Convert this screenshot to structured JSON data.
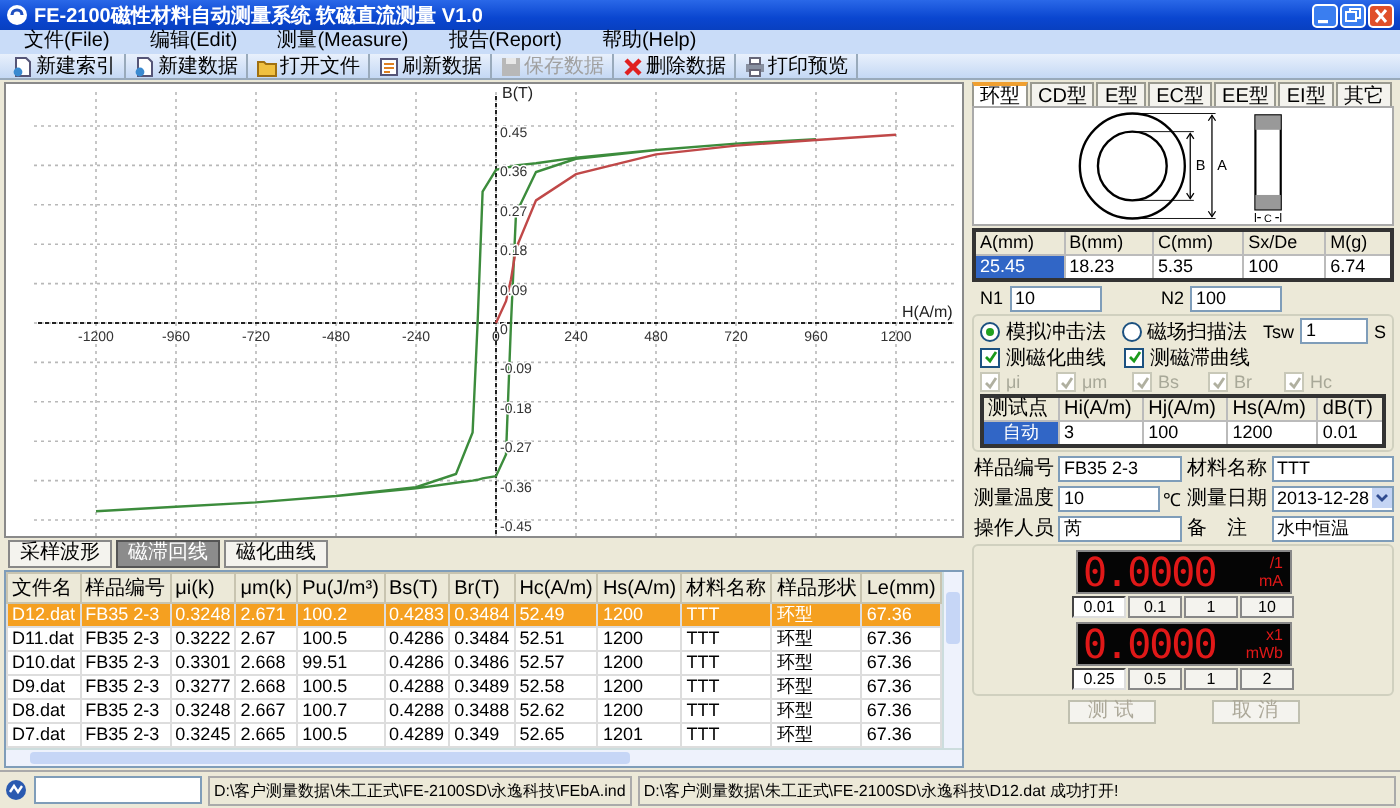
{
  "window": {
    "title": "FE-2100磁性材料自动测量系统 软磁直流测量 V1.0"
  },
  "menu": [
    "文件(File)",
    "编辑(Edit)",
    "测量(Measure)",
    "报告(Report)",
    "帮助(Help)"
  ],
  "toolbar": [
    {
      "label": "新建索引",
      "disabled": false
    },
    {
      "label": "新建数据",
      "disabled": false
    },
    {
      "label": "打开文件",
      "disabled": false
    },
    {
      "label": "刷新数据",
      "disabled": false
    },
    {
      "label": "保存数据",
      "disabled": true
    },
    {
      "label": "删除数据",
      "disabled": false
    },
    {
      "label": "打印预览",
      "disabled": false
    }
  ],
  "chart": {
    "chart_data": {
      "type": "line",
      "xlabel": "H(A/m)",
      "ylabel": "B(T)",
      "x": [
        -1200,
        -960,
        -720,
        -480,
        -240,
        -120,
        -70,
        -55,
        -40,
        0,
        30,
        45,
        60,
        120,
        240,
        480,
        720,
        960,
        1200
      ],
      "series": [
        {
          "color": "#3c8c3c",
          "values": [
            -0.43,
            -0.42,
            -0.41,
            -0.395,
            -0.375,
            -0.345,
            -0.25,
            0.0,
            0.3,
            0.35,
            0.355,
            0.357,
            0.36,
            0.365,
            0.378,
            0.395,
            0.41,
            0.42,
            null
          ]
        },
        {
          "color": "#3c8c3c",
          "values": [
            -0.43,
            -0.42,
            -0.41,
            -0.395,
            -0.378,
            -0.365,
            -0.36,
            -0.358,
            -0.355,
            -0.35,
            -0.3,
            0.0,
            0.25,
            0.345,
            0.375,
            0.395,
            0.41,
            0.42,
            null
          ]
        },
        {
          "color": "#c04848",
          "values": [
            null,
            null,
            null,
            null,
            null,
            null,
            null,
            null,
            null,
            0.0,
            0.05,
            0.1,
            0.17,
            0.28,
            0.34,
            0.385,
            0.405,
            0.418,
            0.43
          ]
        }
      ],
      "grid": true,
      "xlim": [
        -1200,
        1200
      ],
      "ylim": [
        -0.45,
        0.45
      ],
      "xticks": [
        -1200,
        -960,
        -720,
        -480,
        -240,
        0,
        240,
        480,
        720,
        960,
        1200
      ],
      "yticks": [
        -0.45,
        -0.36,
        -0.27,
        -0.18,
        -0.09,
        0,
        0.09,
        0.18,
        0.27,
        0.36,
        0.45
      ]
    }
  },
  "view_tabs": [
    {
      "label": "采样波形",
      "selected": false
    },
    {
      "label": "磁滞回线",
      "selected": true
    },
    {
      "label": "磁化曲线",
      "selected": false
    }
  ],
  "table": {
    "columns": [
      "文件名",
      "样品编号",
      "μi(k)",
      "μm(k)",
      "Pu(J/m³)",
      "Bs(T)",
      "Br(T)",
      "Hc(A/m)",
      "Hs(A/m)",
      "材料名称",
      "样品形状",
      "Le(mm)"
    ],
    "rows": [
      {
        "selected": true,
        "cells": [
          "D12.dat",
          "FB35 2-3",
          "0.3248",
          "2.671",
          "100.2",
          "0.4283",
          "0.3484",
          "52.49",
          "1200",
          "TTT",
          "环型",
          "67.36"
        ]
      },
      {
        "selected": false,
        "cells": [
          "D11.dat",
          "FB35 2-3",
          "0.3222",
          "2.67",
          "100.5",
          "0.4286",
          "0.3484",
          "52.51",
          "1200",
          "TTT",
          "环型",
          "67.36"
        ]
      },
      {
        "selected": false,
        "cells": [
          "D10.dat",
          "FB35 2-3",
          "0.3301",
          "2.668",
          "99.51",
          "0.4286",
          "0.3486",
          "52.57",
          "1200",
          "TTT",
          "环型",
          "67.36"
        ]
      },
      {
        "selected": false,
        "cells": [
          "D9.dat",
          "FB35 2-3",
          "0.3277",
          "2.668",
          "100.5",
          "0.4288",
          "0.3489",
          "52.58",
          "1200",
          "TTT",
          "环型",
          "67.36"
        ]
      },
      {
        "selected": false,
        "cells": [
          "D8.dat",
          "FB35 2-3",
          "0.3248",
          "2.667",
          "100.7",
          "0.4288",
          "0.3488",
          "52.62",
          "1200",
          "TTT",
          "环型",
          "67.36"
        ]
      },
      {
        "selected": false,
        "cells": [
          "D7.dat",
          "FB35 2-3",
          "0.3245",
          "2.665",
          "100.5",
          "0.4289",
          "0.349",
          "52.65",
          "1201",
          "TTT",
          "环型",
          "67.36"
        ]
      }
    ]
  },
  "shape_tabs": [
    {
      "label": "环型",
      "selected": true
    },
    {
      "label": "CD型",
      "selected": false
    },
    {
      "label": "E型",
      "selected": false
    },
    {
      "label": "EC型",
      "selected": false
    },
    {
      "label": "EE型",
      "selected": false
    },
    {
      "label": "EI型",
      "selected": false
    },
    {
      "label": "其它",
      "selected": false
    }
  ],
  "drawing_labels": [
    "B",
    "A",
    "C"
  ],
  "dimensions": {
    "columns": [
      "A(mm)",
      "B(mm)",
      "C(mm)",
      "Sx/De",
      "M(g)"
    ],
    "values": [
      {
        "text": "25.45",
        "selected": true
      },
      {
        "text": "18.23",
        "selected": false
      },
      {
        "text": "5.35",
        "selected": false
      },
      {
        "text": "100",
        "selected": false
      },
      {
        "text": "6.74",
        "selected": false
      }
    ]
  },
  "turns": [
    {
      "label": "N1",
      "value": "10"
    },
    {
      "label": "N2",
      "value": "100"
    }
  ],
  "methods": [
    {
      "label": "模拟冲击法",
      "selected": true
    },
    {
      "label": "磁场扫描法",
      "selected": false
    }
  ],
  "tsw": {
    "label": "Tsw",
    "value": "1",
    "unit": "S"
  },
  "curves": [
    {
      "label": "测磁化曲线",
      "checked": true
    },
    {
      "label": "测磁滞曲线",
      "checked": true
    }
  ],
  "params": [
    {
      "label": "μi",
      "checked": true,
      "disabled": true
    },
    {
      "label": "μm",
      "checked": true,
      "disabled": true
    },
    {
      "label": "Bs",
      "checked": true,
      "disabled": true
    },
    {
      "label": "Br",
      "checked": true,
      "disabled": true
    },
    {
      "label": "Hc",
      "checked": true,
      "disabled": true
    }
  ],
  "test_points": {
    "columns": [
      "测试点",
      "Hi(A/m)",
      "Hj(A/m)",
      "Hs(A/m)",
      "dB(T)"
    ],
    "values": [
      "自动",
      "3",
      "100",
      "1200",
      "0.01"
    ]
  },
  "sample_fields": [
    {
      "label": "样品编号",
      "value": "FB35 2-3",
      "kind": "text"
    },
    {
      "label": "材料名称",
      "value": "TTT",
      "kind": "text"
    },
    {
      "label": "测量温度",
      "value": "10",
      "unit": "℃",
      "kind": "text"
    },
    {
      "label": "测量日期",
      "value": "2013-12-28",
      "kind": "date"
    },
    {
      "label": "操作人员",
      "value": "芮",
      "kind": "text"
    },
    {
      "label": "备　注",
      "value": "水中恒温",
      "kind": "text"
    }
  ],
  "meters": [
    {
      "reading": "0.0000",
      "scale": "/1",
      "unit": "mA",
      "ranges": [
        {
          "label": "0.01",
          "selected": true
        },
        {
          "label": "0.1",
          "selected": false
        },
        {
          "label": "1",
          "selected": false
        },
        {
          "label": "10",
          "selected": false
        }
      ]
    },
    {
      "reading": "0.0000",
      "scale": "x1",
      "unit": "mWb",
      "ranges": [
        {
          "label": "0.25",
          "selected": true
        },
        {
          "label": "0.5",
          "selected": false
        },
        {
          "label": "1",
          "selected": false
        },
        {
          "label": "2",
          "selected": false
        }
      ]
    }
  ],
  "actions": [
    {
      "label": "测 试",
      "disabled": true
    },
    {
      "label": "取 消",
      "disabled": true
    }
  ],
  "status_bar": {
    "index_path": "D:\\客户测量数据\\朱工正式\\FE-2100SD\\永逸科技\\FEbA.ind",
    "message": "D:\\客户测量数据\\朱工正式\\FE-2100SD\\永逸科技\\D12.dat 成功打开!"
  }
}
